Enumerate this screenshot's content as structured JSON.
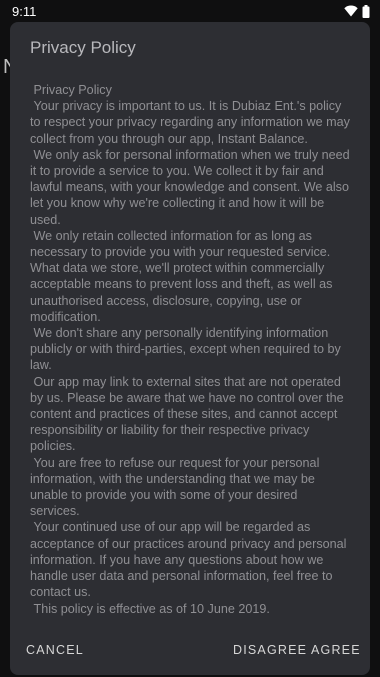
{
  "status_bar": {
    "time": "9:11",
    "icons": [
      "wifi-icon",
      "battery-icon"
    ]
  },
  "background": {
    "partial_text": "N"
  },
  "dialog": {
    "title": "Privacy Policy",
    "body": " Privacy Policy\n Your privacy is important to us. It is Dubiaz Ent.'s policy to respect your privacy regarding any information we may collect from you through our app, Instant Balance.\n We only ask for personal information when we truly need it to provide a service to you. We collect it by fair and lawful means, with your knowledge and consent. We also let you know why we're collecting it and how it will be used.\n We only retain collected information for as long as necessary to provide you with your requested service. What data we store, we'll protect within commercially acceptable means to prevent loss and theft, as well as unauthorised access, disclosure, copying, use or modification.\n We don't share any personally identifying information publicly or with third-parties, except when required to by law.\n Our app may link to external sites that are not operated by us. Please be aware that we have no control over the content and practices of these sites, and cannot accept responsibility or liability for their respective privacy policies.\n You are free to refuse our request for your personal information, with the understanding that we may be unable to provide you with some of your desired services.\n Your continued use of our app will be regarded as acceptance of our practices around privacy and personal information. If you have any questions about how we handle user data and personal information, feel free to contact us.\n This policy is effective as of 10 June 2019.",
    "buttons": {
      "cancel": "CANCEL",
      "disagree": "DISAGREE",
      "agree": "AGREE"
    }
  },
  "colors": {
    "dialog_background": "#2d2e33",
    "body_text": "#8f8f93",
    "title_text": "#b8b8bc",
    "button_text": "#d6d6d6"
  }
}
